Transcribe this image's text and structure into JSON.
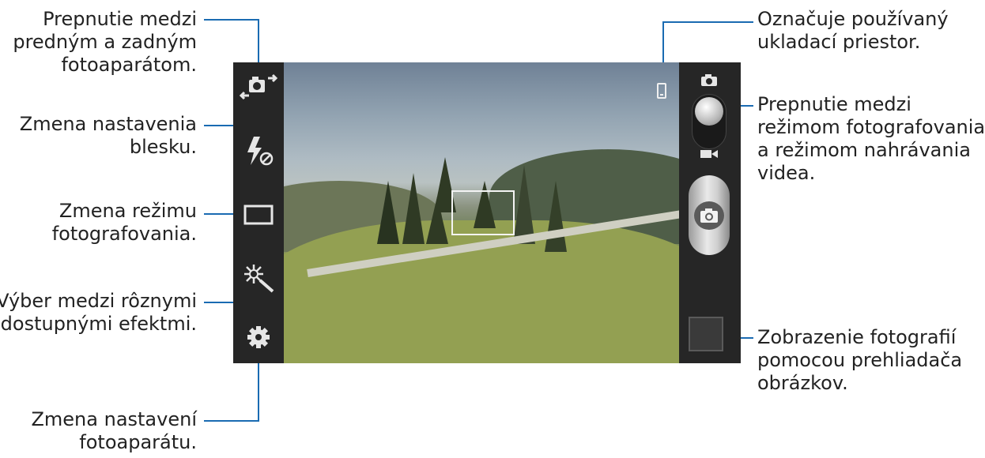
{
  "callouts": {
    "switch_camera": [
      "Prepnutie medzi",
      "predným a zadným",
      "fotoaparátom."
    ],
    "flash": [
      "Zmena nastavenia",
      "blesku."
    ],
    "shooting_mode": [
      "Zmena režimu",
      "fotografovania."
    ],
    "effects": [
      "Výber medzi rôznymi",
      "dostupnými efektmi."
    ],
    "settings": [
      "Zmena nastavení",
      "fotoaparátu."
    ],
    "storage": [
      "Označuje používaný",
      "ukladací priestor."
    ],
    "mode_switch": [
      "Prepnutie medzi",
      "režimom fotografovania",
      "a režimom nahrávania",
      "videa."
    ],
    "gallery": [
      "Zobrazenie fotografií",
      "pomocou prehliadača",
      "obrázkov."
    ]
  },
  "colors": {
    "callout_line": "#1a6bb2",
    "panel": "#262626"
  },
  "icons": {
    "left_panel": [
      "switch-camera-icon",
      "flash-off-icon",
      "shooting-mode-icon",
      "effects-wand-icon",
      "settings-gear-icon"
    ],
    "right_panel": [
      "camera-mode-icon",
      "mode-toggle-switch",
      "video-mode-icon",
      "shutter-button",
      "gallery-thumbnail"
    ],
    "viewfinder": [
      "storage-phone-icon",
      "focus-frame"
    ]
  }
}
